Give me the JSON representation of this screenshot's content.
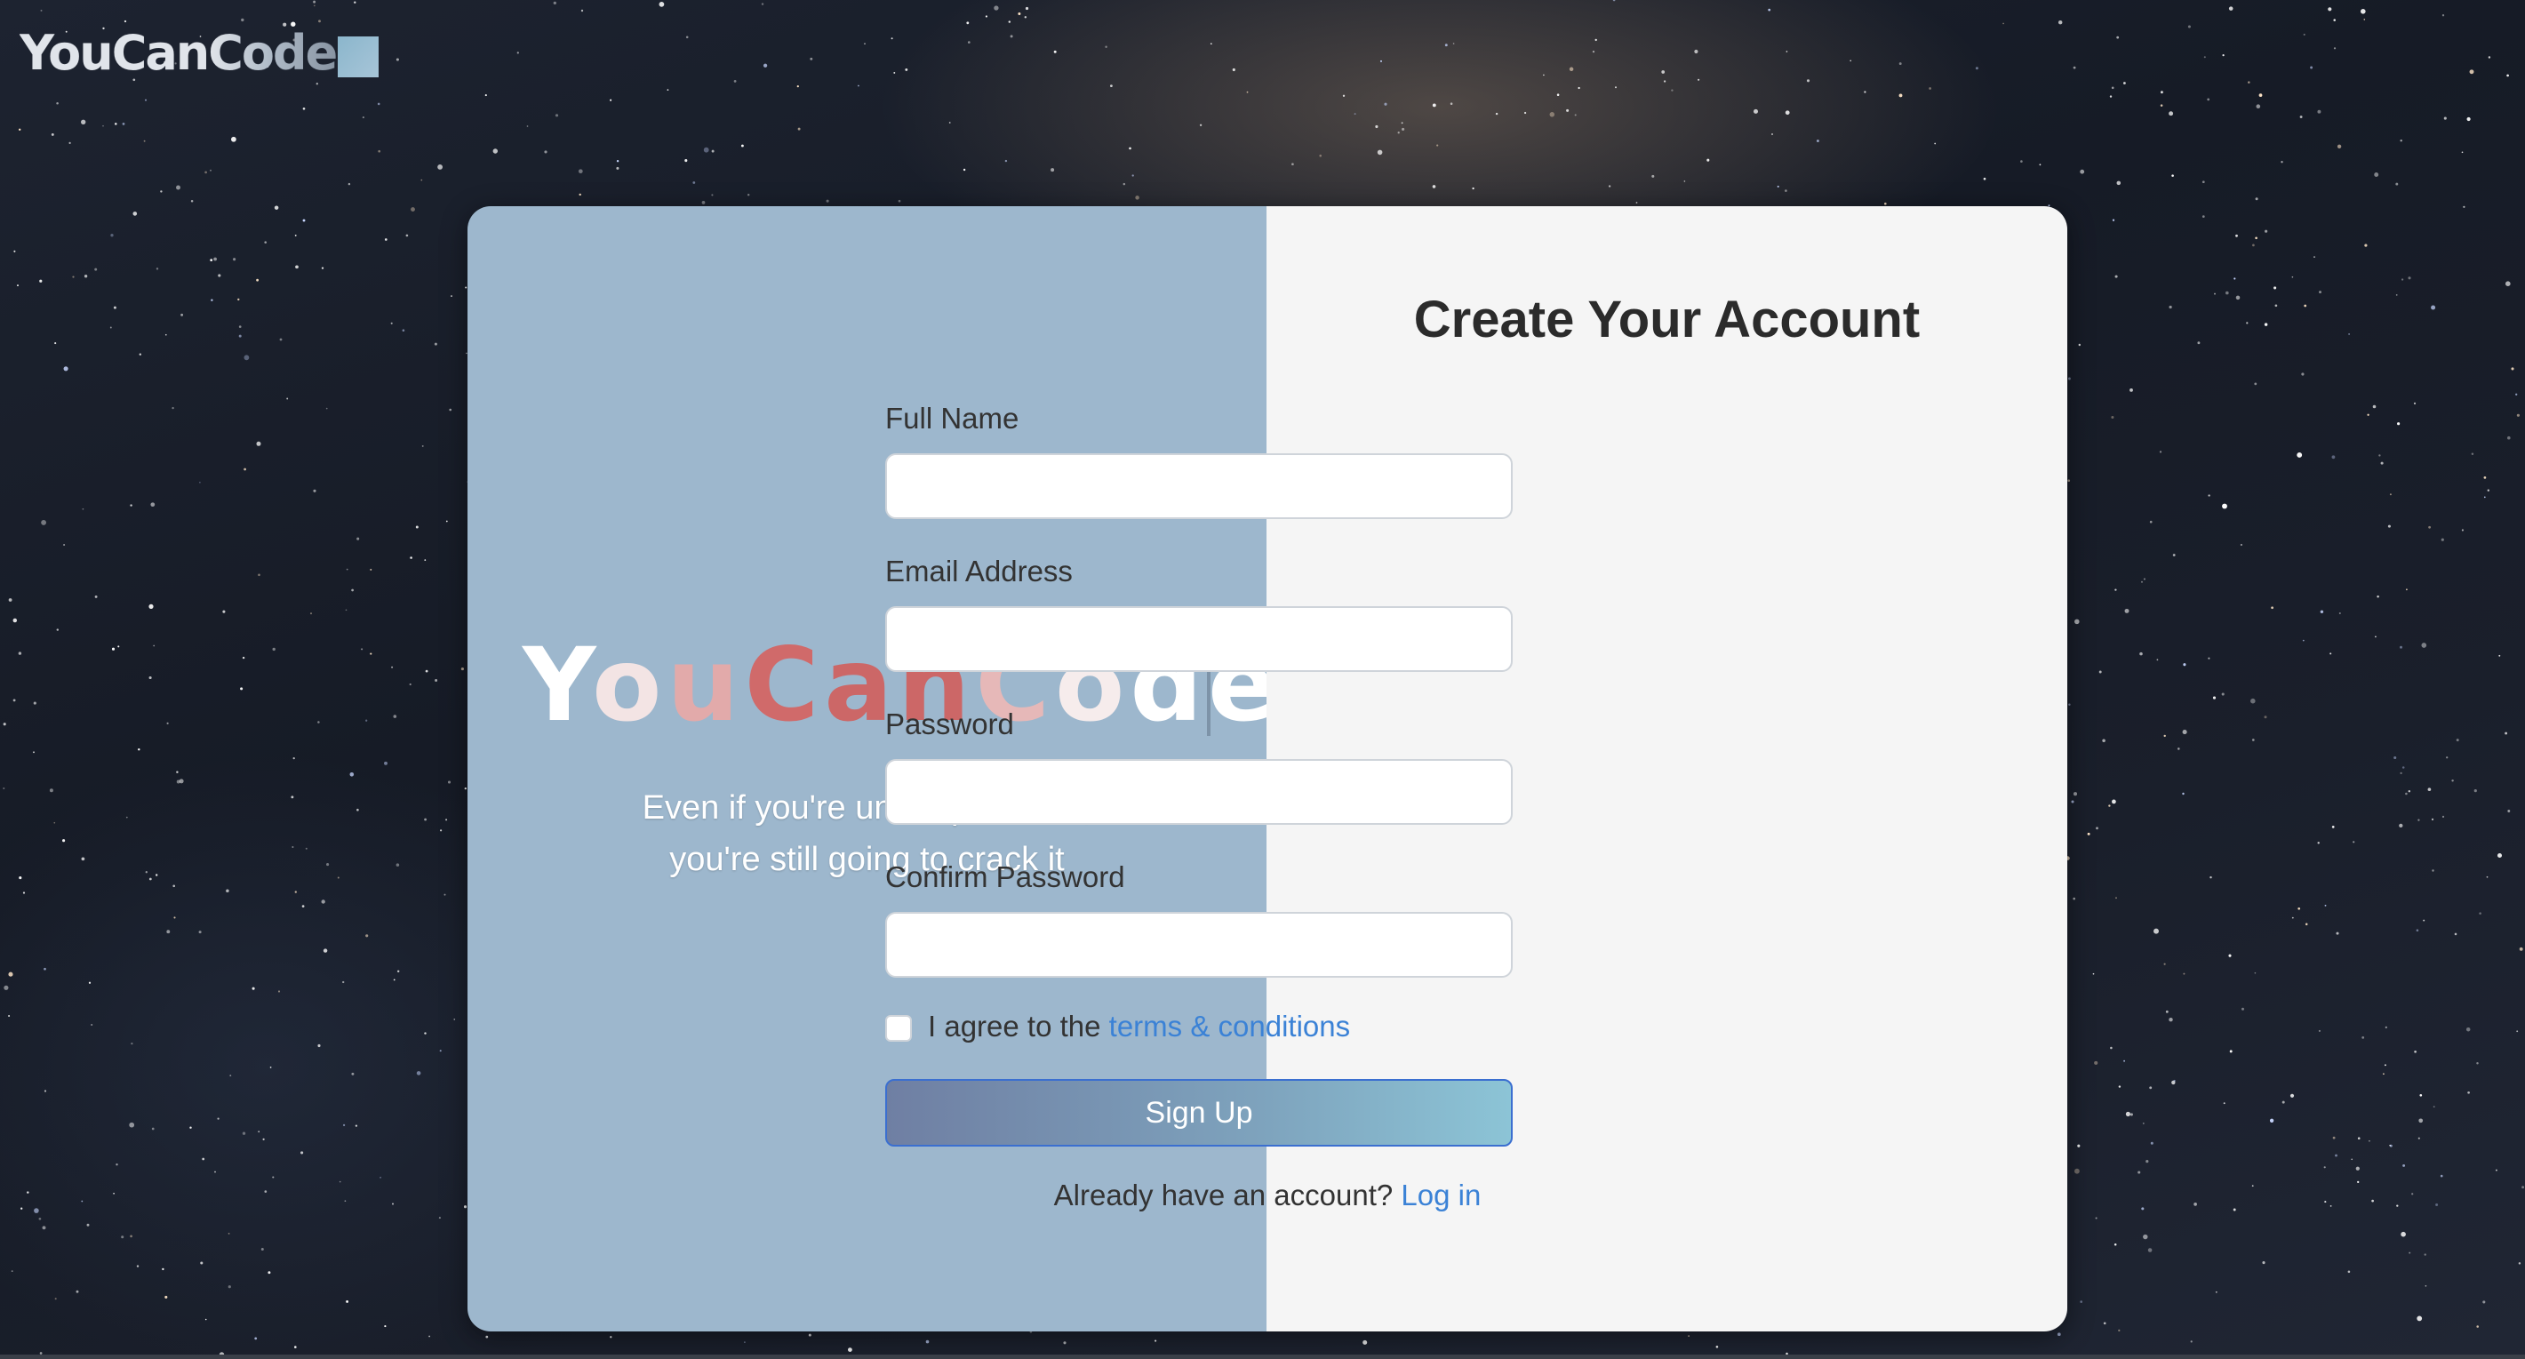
{
  "brand": {
    "logo_text": "YouCanCode"
  },
  "hero": {
    "title_letters": [
      "Y",
      "o",
      "u",
      "C",
      "a",
      "n",
      "C",
      "o",
      "d",
      "e"
    ],
    "tagline_line1": "Even if you're under pressure,",
    "tagline_line2": "you're still going to crack it"
  },
  "form": {
    "title": "Create Your Account",
    "full_name_label": "Full Name",
    "full_name_value": "",
    "email_label": "Email Address",
    "email_value": "",
    "password_label": "Password",
    "password_value": "",
    "confirm_password_label": "Confirm Password",
    "confirm_password_value": "",
    "agree_prefix": "I agree to the",
    "terms_link": "terms & conditions",
    "agree_checked": false,
    "signup_label": "Sign Up",
    "login_prompt": "Already have an account?",
    "login_link": "Log in"
  },
  "colors": {
    "left_panel": "#9db7cd",
    "right_panel": "#f5f5f5",
    "link": "#3b82d6",
    "accent_title": "#cc6767",
    "button_gradient_start": "#6f7fa3",
    "button_gradient_end": "#8cc4d6"
  }
}
